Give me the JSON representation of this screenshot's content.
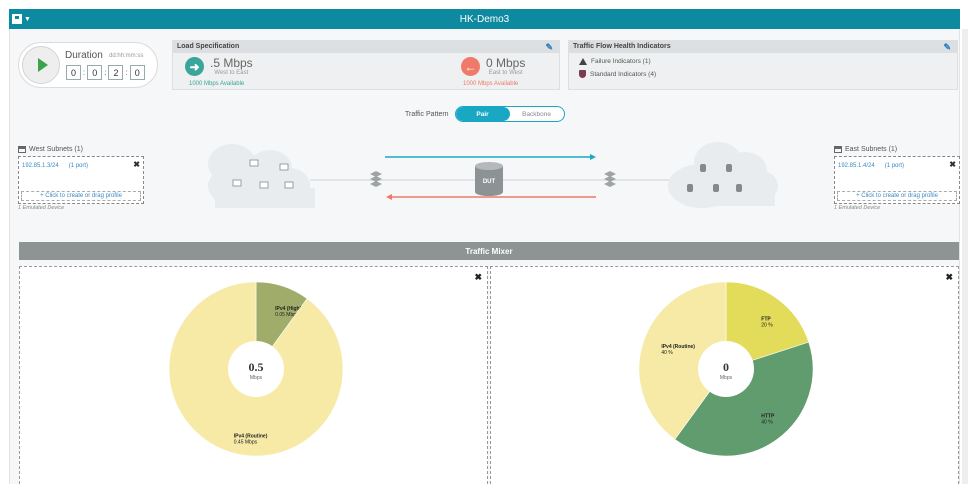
{
  "window": {
    "title": "HK-Demo3"
  },
  "duration": {
    "label": "Duration",
    "format": "dd:hh:mm:ss",
    "values": [
      "0",
      "0",
      "2",
      "0"
    ]
  },
  "load_spec": {
    "title": "Load Specification",
    "west_to_east": {
      "value": ".5 Mbps",
      "label": "West to East",
      "available": "1000 Mbps Available",
      "color": "#3aa59a"
    },
    "east_to_west": {
      "value": "0 Mbps",
      "label": "East to West",
      "available": "1000 Mbps Available",
      "color": "#ef7a6a"
    }
  },
  "flow_health": {
    "title": "Traffic Flow Health Indicators",
    "failure": "Failure Indicators (1)",
    "standard": "Standard Indicators (4)"
  },
  "traffic_pattern": {
    "label": "Traffic Pattern",
    "options": [
      "Pair",
      "Backbone"
    ],
    "selected": "Pair"
  },
  "west_subnets": {
    "title": "West Subnets (1)",
    "address": "192.85.1.3/24",
    "port": "(1 port)",
    "drop_hint": "+ Click to create or drag profile",
    "emulated": "1 Emulated Device"
  },
  "east_subnets": {
    "title": "East Subnets (1)",
    "address": "192.85.1.4/24",
    "port": "(1 port)",
    "drop_hint": "+ Click to create or drag profile",
    "emulated": "1 Emulated Device"
  },
  "topology": {
    "dut_label": "DUT",
    "arrow_east_color": "#1ea6c4",
    "arrow_west_color": "#ef7a6a"
  },
  "mixer": {
    "title": "Traffic Mixer",
    "left": {
      "center_value": "0.5",
      "center_unit": "Mbps",
      "slices": [
        {
          "name": "IPv4 (High)",
          "value_label": "0.05 Mbps",
          "fraction": 0.1,
          "color": "#a0ad6a"
        },
        {
          "name": "IPv4 (Routine)",
          "value_label": "0.45 Mbps",
          "fraction": 0.9,
          "color": "#f6eaa6"
        }
      ]
    },
    "right": {
      "center_value": "0",
      "center_unit": "Mbps",
      "slices": [
        {
          "name": "FTP",
          "value_label": "20 %",
          "fraction": 0.2,
          "color": "#e2dc5a"
        },
        {
          "name": "HTTP",
          "value_label": "40 %",
          "fraction": 0.4,
          "color": "#609c6e"
        },
        {
          "name": "IPv4 (Routine)",
          "value_label": "40 %",
          "fraction": 0.4,
          "color": "#f6eaa6"
        }
      ]
    }
  }
}
